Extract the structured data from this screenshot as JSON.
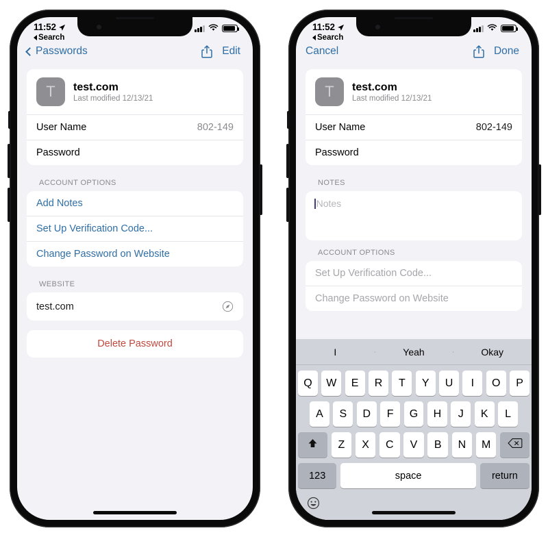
{
  "status_bar": {
    "time": "11:52",
    "location_icon": "location-arrow-icon",
    "back_label": "Search",
    "signal_icon": "cellular-signal-icon",
    "wifi_icon": "wifi-icon",
    "battery_icon": "battery-icon"
  },
  "left_phone": {
    "nav": {
      "back_label": "Passwords",
      "share_icon": "share-icon",
      "edit_label": "Edit"
    },
    "card": {
      "icon_letter": "T",
      "site": "test.com",
      "subtitle": "Last modified 12/13/21",
      "rows": [
        {
          "label": "User Name",
          "value": "802-149"
        },
        {
          "label": "Password",
          "value": ""
        }
      ]
    },
    "account_options": {
      "header": "ACCOUNT OPTIONS",
      "items": [
        "Add Notes",
        "Set Up Verification Code...",
        "Change Password on Website"
      ]
    },
    "website": {
      "header": "WEBSITE",
      "value": "test.com",
      "icon": "safari-compass-icon"
    },
    "delete_label": "Delete Password"
  },
  "right_phone": {
    "nav": {
      "cancel_label": "Cancel",
      "share_icon": "share-icon",
      "done_label": "Done"
    },
    "card": {
      "icon_letter": "T",
      "site": "test.com",
      "subtitle": "Last modified 12/13/21",
      "rows": [
        {
          "label": "User Name",
          "value": "802-149"
        },
        {
          "label": "Password",
          "value": ""
        }
      ]
    },
    "notes": {
      "header": "NOTES",
      "placeholder": "Notes",
      "value": ""
    },
    "account_options": {
      "header": "ACCOUNT OPTIONS",
      "items": [
        "Set Up Verification Code...",
        "Change Password on Website"
      ]
    },
    "keyboard": {
      "predictions": [
        "I",
        "Yeah",
        "Okay"
      ],
      "row1": [
        "Q",
        "W",
        "E",
        "R",
        "T",
        "Y",
        "U",
        "I",
        "O",
        "P"
      ],
      "row2": [
        "A",
        "S",
        "D",
        "F",
        "G",
        "H",
        "J",
        "K",
        "L"
      ],
      "row3": [
        "Z",
        "X",
        "C",
        "V",
        "B",
        "N",
        "M"
      ],
      "shift_icon": "shift-arrow-icon",
      "backspace_icon": "backspace-icon",
      "numbers_label": "123",
      "space_label": "space",
      "return_label": "return",
      "emoji_icon": "emoji-smiley-icon"
    }
  },
  "colors": {
    "accent": "#2f6ea5",
    "destructive": "#c0483f",
    "background": "#f2f2f7",
    "card": "#ffffff",
    "keyboard_bg": "#d0d3d9"
  }
}
